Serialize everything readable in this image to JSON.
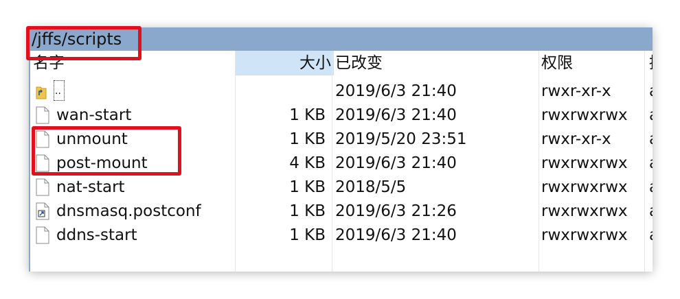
{
  "path": "/jffs/scripts",
  "columns": {
    "name": "名字",
    "size": "大小",
    "modified": "已改变",
    "permissions": "权限",
    "owner": "拥"
  },
  "files": [
    {
      "name": "..",
      "size": "",
      "modified": "2019/6/3 21:40",
      "permissions": "rwxr-xr-x",
      "owner": "a",
      "icon": "parent-folder-icon"
    },
    {
      "name": "wan-start",
      "size": "1 KB",
      "modified": "2019/6/3 21:40",
      "permissions": "rwxrwxrwx",
      "owner": "a",
      "icon": "file-icon"
    },
    {
      "name": "unmount",
      "size": "1 KB",
      "modified": "2019/5/20 23:51",
      "permissions": "rwxr-xr-x",
      "owner": "a",
      "icon": "file-icon"
    },
    {
      "name": "post-mount",
      "size": "4 KB",
      "modified": "2019/6/3 21:40",
      "permissions": "rwxrwxrwx",
      "owner": "a",
      "icon": "file-icon"
    },
    {
      "name": "nat-start",
      "size": "1 KB",
      "modified": "2018/5/5",
      "permissions": "rwxrwxrwx",
      "owner": "a",
      "icon": "file-icon"
    },
    {
      "name": "dnsmasq.postconf",
      "size": "1 KB",
      "modified": "2019/6/3 21:26",
      "permissions": "rwxrwxrwx",
      "owner": "a",
      "icon": "shortcut-file-icon"
    },
    {
      "name": "ddns-start",
      "size": "1 KB",
      "modified": "2019/6/3 21:40",
      "permissions": "rwxrwxrwx",
      "owner": "a",
      "icon": "file-icon"
    }
  ],
  "colors": {
    "pathbar": "#8aa8cc",
    "sorted_header": "#cfe4f7",
    "highlight": "#e0101c"
  }
}
